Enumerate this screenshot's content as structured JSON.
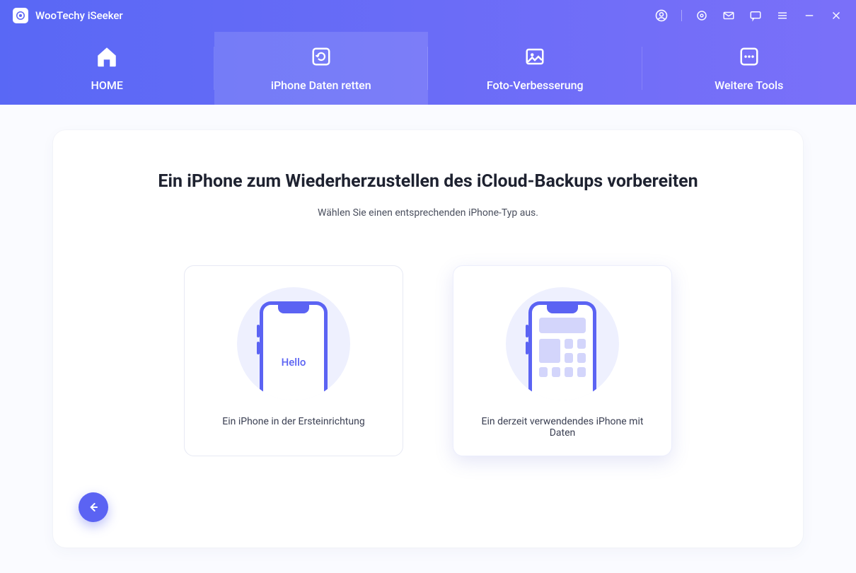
{
  "app": {
    "title": "WooTechy iSeeker"
  },
  "titlebar_icons": {
    "account": "account-icon",
    "settings": "settings-icon",
    "mail": "mail-icon",
    "feedback": "feedback-icon",
    "menu": "menu-icon",
    "minimize": "minimize-icon",
    "close": "close-icon"
  },
  "nav": [
    {
      "id": "home",
      "label": "HOME",
      "icon": "home-icon",
      "active": false
    },
    {
      "id": "recover",
      "label": "iPhone Daten retten",
      "icon": "refresh-icon",
      "active": true
    },
    {
      "id": "photo",
      "label": "Foto-Verbesserung",
      "icon": "image-icon",
      "active": false
    },
    {
      "id": "more",
      "label": "Weitere Tools",
      "icon": "more-icon",
      "active": false
    }
  ],
  "panel": {
    "title": "Ein iPhone zum Wiederherzustellen des iCloud-Backups vorbereiten",
    "subtitle": "Wählen Sie einen entsprechenden iPhone-Typ aus."
  },
  "cards": [
    {
      "id": "setup",
      "label": "Ein iPhone in der Ersteinrichtung",
      "phone_text": "Hello",
      "selected": false
    },
    {
      "id": "inuse",
      "label": "Ein derzeit verwendendes iPhone mit Daten",
      "phone_text": "",
      "selected": true
    }
  ]
}
